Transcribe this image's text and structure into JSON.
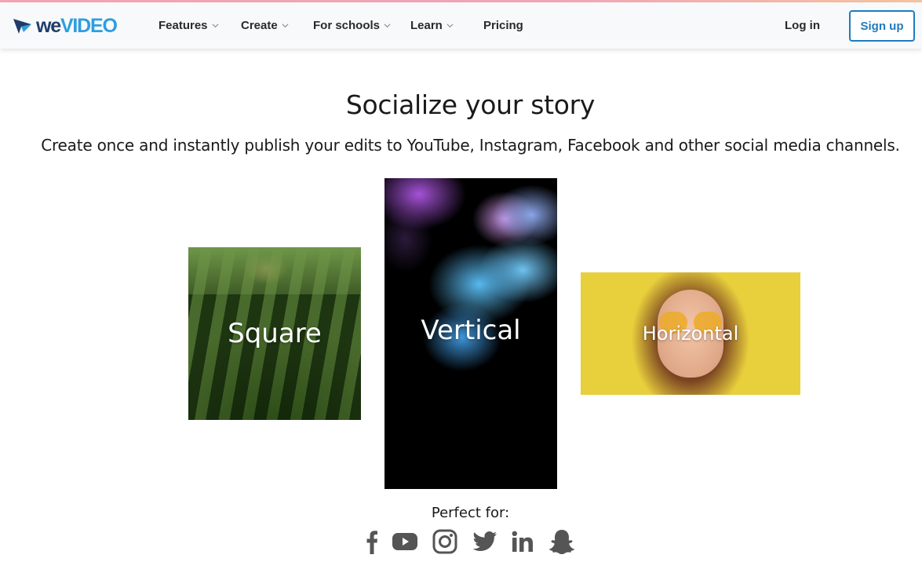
{
  "brand": {
    "logo_text_we": "we",
    "logo_text_video": "VIDEO",
    "accent_color": "#1f7bbf",
    "logo_dark_color": "#1f3d6a",
    "logo_light_color": "#2d9ee0"
  },
  "nav": {
    "items": [
      {
        "label": "Features",
        "has_dropdown": true
      },
      {
        "label": "Create",
        "has_dropdown": true
      },
      {
        "label": "For schools",
        "has_dropdown": true
      },
      {
        "label": "Learn",
        "has_dropdown": true
      },
      {
        "label": "Pricing",
        "has_dropdown": false
      }
    ],
    "login_label": "Log in",
    "signup_label": "Sign up"
  },
  "hero": {
    "title": "Socialize your story",
    "subtitle": "Create once and instantly publish your edits to YouTube, Instagram, Facebook and other social media channels."
  },
  "formats": [
    {
      "label": "Square"
    },
    {
      "label": "Vertical"
    },
    {
      "label": "Horizontal"
    }
  ],
  "perfect_for": {
    "label": "Perfect for:",
    "icons": [
      "facebook-icon",
      "youtube-icon",
      "instagram-icon",
      "twitter-icon",
      "linkedin-icon",
      "snapchat-icon"
    ],
    "icon_color": "#555555"
  }
}
